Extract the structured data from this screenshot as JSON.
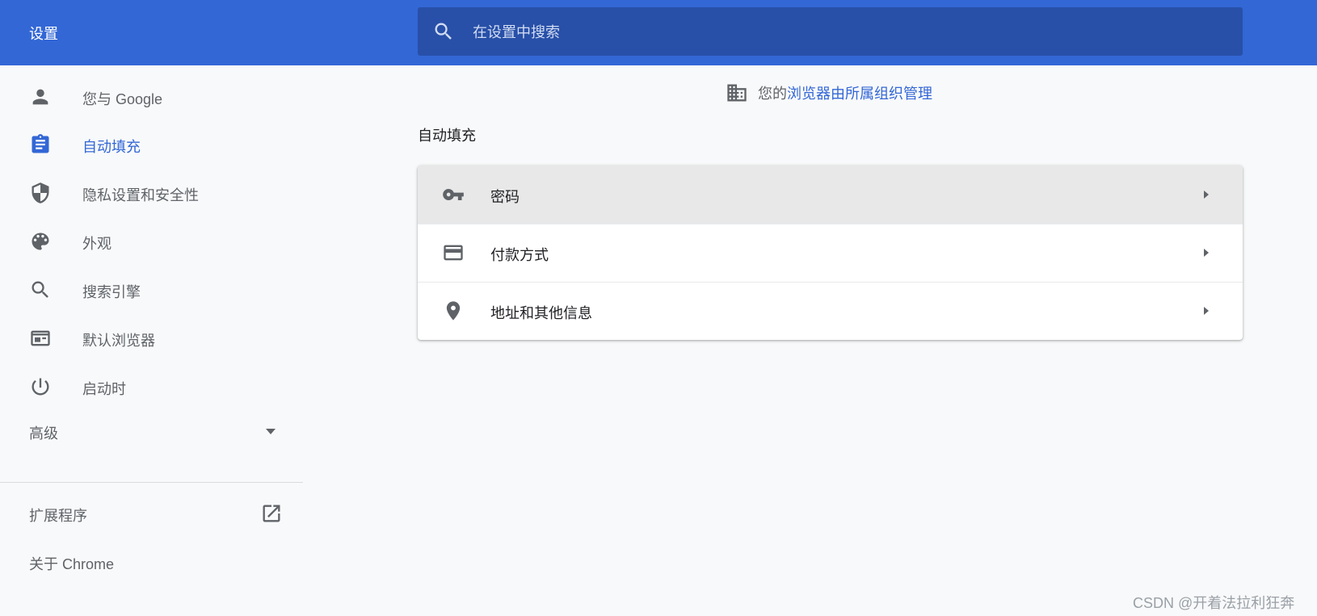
{
  "header": {
    "title": "设置",
    "search_placeholder": "在设置中搜索"
  },
  "sidebar": {
    "items": [
      {
        "label": "您与 Google",
        "icon": "person-icon",
        "active": false
      },
      {
        "label": "自动填充",
        "icon": "clipboard-icon",
        "active": true
      },
      {
        "label": "隐私设置和安全性",
        "icon": "shield-icon",
        "active": false
      },
      {
        "label": "外观",
        "icon": "palette-icon",
        "active": false
      },
      {
        "label": "搜索引擎",
        "icon": "search-icon",
        "active": false
      },
      {
        "label": "默认浏览器",
        "icon": "browser-window-icon",
        "active": false
      },
      {
        "label": "启动时",
        "icon": "power-icon",
        "active": false
      }
    ],
    "advanced_label": "高级",
    "extensions_label": "扩展程序",
    "about_label": "关于 Chrome"
  },
  "main": {
    "managed_prefix": "您的",
    "managed_link": "浏览器由所属组织管理",
    "section_title": "自动填充",
    "rows": [
      {
        "label": "密码",
        "icon": "key-icon"
      },
      {
        "label": "付款方式",
        "icon": "credit-card-icon"
      },
      {
        "label": "地址和其他信息",
        "icon": "location-pin-icon"
      }
    ]
  },
  "watermark": "CSDN @开着法拉利狂奔",
  "colors": {
    "accent": "#3367d6",
    "header_bg": "#3367d6",
    "search_bg": "#2850a8",
    "page_bg": "#f8f9fa",
    "icon_gray": "#5f6368"
  }
}
